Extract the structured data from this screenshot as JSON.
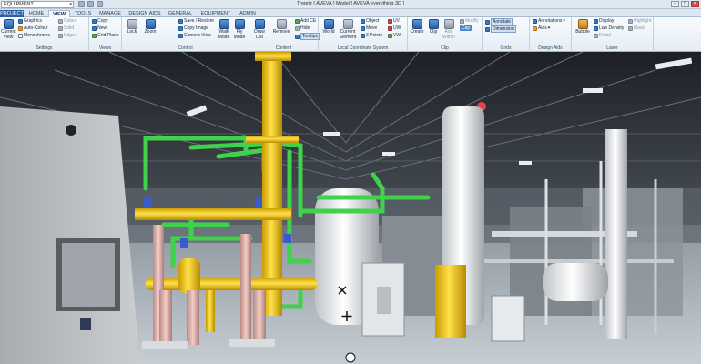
{
  "window": {
    "title": "Trepriz [ AVEVA ] Model [ AVEVA everything 3D ]",
    "combo_value": "EQUIPMENT",
    "controls": {
      "minimize": "–",
      "maximize": "□",
      "close": "✕"
    }
  },
  "tabs": [
    "PROJECT",
    "HOME",
    "VIEW",
    "TOOLS",
    "MANAGE",
    "DESIGN AIDS",
    "GENERAL",
    "EQUIPMENT",
    "ADMIN"
  ],
  "ribbon": {
    "settings": {
      "label": "Settings",
      "big": "Current View",
      "graphics": "Graphics",
      "auto_colour": "Auto-Colour",
      "monochrome": "Monochrome",
      "colour": "Colour",
      "solid": "Solid",
      "edges": "Edges"
    },
    "views": {
      "label": "Views",
      "copy": "Copy",
      "new": "New",
      "grid_plane": "Grid Plane"
    },
    "control": {
      "label": "Control",
      "lock": "Lock",
      "zoom": "Zoom",
      "save_restore": "Save / Restore",
      "copy_image": "Copy Image",
      "camera_view": "Camera View",
      "walk_mode": "Walk Mode",
      "fly_mode": "Fly Mode"
    },
    "content": {
      "label": "Content",
      "draw_list": "Draw List",
      "remove": "Remove",
      "add_ce": "Add CE",
      "hide": "Hide",
      "tooltips": "Tooltips"
    },
    "lcs": {
      "label": "Local Coordinate System",
      "world": "World",
      "current_element": "Current Element",
      "object": "Object",
      "move": "Move",
      "three_points": "3 Points",
      "uv": "UV",
      "uw": "UW",
      "vw": "VW"
    },
    "clip": {
      "label": "Clip",
      "create": "Create",
      "clip": "Clip",
      "add_within": "Add Within",
      "modify": "Modify",
      "cap": "Cap"
    },
    "grids": {
      "label": "Grids",
      "annotate": "Annotate",
      "dimension": "Dimension"
    },
    "design_aids": {
      "label": "Design Aids",
      "annotations": "Annotations",
      "aids": "Aids"
    },
    "laser": {
      "label": "Laser",
      "bubble": "Bubble",
      "display": "Display",
      "low_density": "Low Density",
      "detail": "Detail",
      "highlight": "Highlight",
      "mask": "Mask"
    }
  }
}
